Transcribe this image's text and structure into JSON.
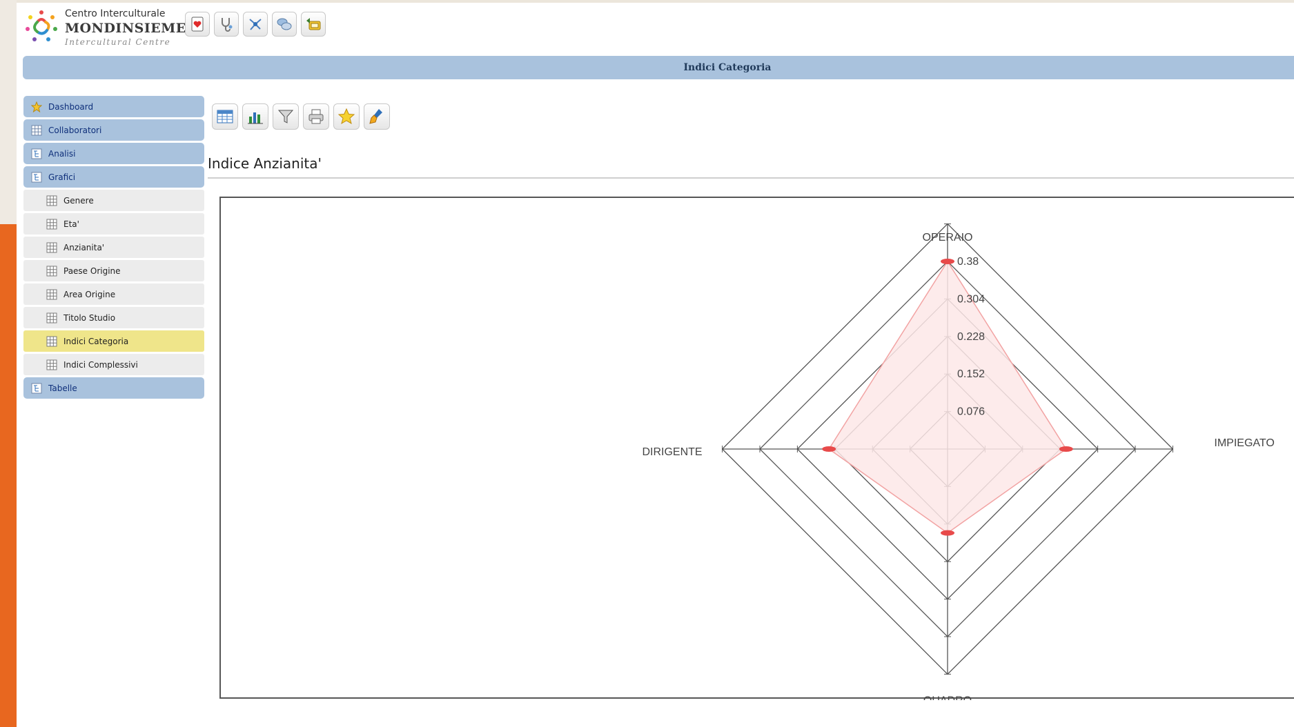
{
  "logo": {
    "line1": "Centro Interculturale",
    "line2": "MONDINSIEME",
    "line3": "Intercultural Centre"
  },
  "toolbar_top": [
    "heart-document-icon",
    "stethoscope-icon",
    "network-icon",
    "chat-bubbles-icon",
    "back-card-icon"
  ],
  "title_bar": {
    "title": "Indici Categoria"
  },
  "sidebar": {
    "items": [
      {
        "label": "Dashboard",
        "icon": "star-icon",
        "level": "top"
      },
      {
        "label": "Collaboratori",
        "icon": "grid-icon",
        "level": "top"
      },
      {
        "label": "Analisi",
        "icon": "tree-icon",
        "level": "top"
      },
      {
        "label": "Grafici",
        "icon": "tree-icon",
        "level": "top"
      },
      {
        "label": "Genere",
        "icon": "grid-icon",
        "level": "sub"
      },
      {
        "label": "Eta'",
        "icon": "grid-icon",
        "level": "sub"
      },
      {
        "label": "Anzianita'",
        "icon": "grid-icon",
        "level": "sub"
      },
      {
        "label": "Paese Origine",
        "icon": "grid-icon",
        "level": "sub"
      },
      {
        "label": "Area Origine",
        "icon": "grid-icon",
        "level": "sub"
      },
      {
        "label": "Titolo Studio",
        "icon": "grid-icon",
        "level": "sub"
      },
      {
        "label": "Indici Categoria",
        "icon": "grid-icon",
        "level": "sub",
        "active": true
      },
      {
        "label": "Indici Complessivi",
        "icon": "grid-icon",
        "level": "sub"
      },
      {
        "label": "Tabelle",
        "icon": "tree-icon",
        "level": "top"
      }
    ]
  },
  "chart_toolbar": [
    "table-icon",
    "bar-chart-icon",
    "filter-icon",
    "print-icon",
    "star-icon",
    "brush-icon"
  ],
  "page_heading": "Indice Anzianita'",
  "colors": {
    "accent": "#a9c2dd",
    "active_item": "#efe58a",
    "series_fill": "#fde7e7",
    "series_stroke": "#f2a3a3",
    "marker": "#e84a4a",
    "side_orange": "#e8671f"
  },
  "chart_data": {
    "type": "radar",
    "categories": [
      "OPERAIO",
      "IMPIEGATO",
      "QUADRO",
      "DIRIGENTE"
    ],
    "series": [
      {
        "values": [
          0.38,
          0.24,
          0.17,
          0.24
        ]
      }
    ],
    "scale_ticks": [
      "0.076",
      "0.152",
      "0.228",
      "0.304",
      "0.38"
    ],
    "max": 0.38,
    "grid": true,
    "legend": "none"
  }
}
